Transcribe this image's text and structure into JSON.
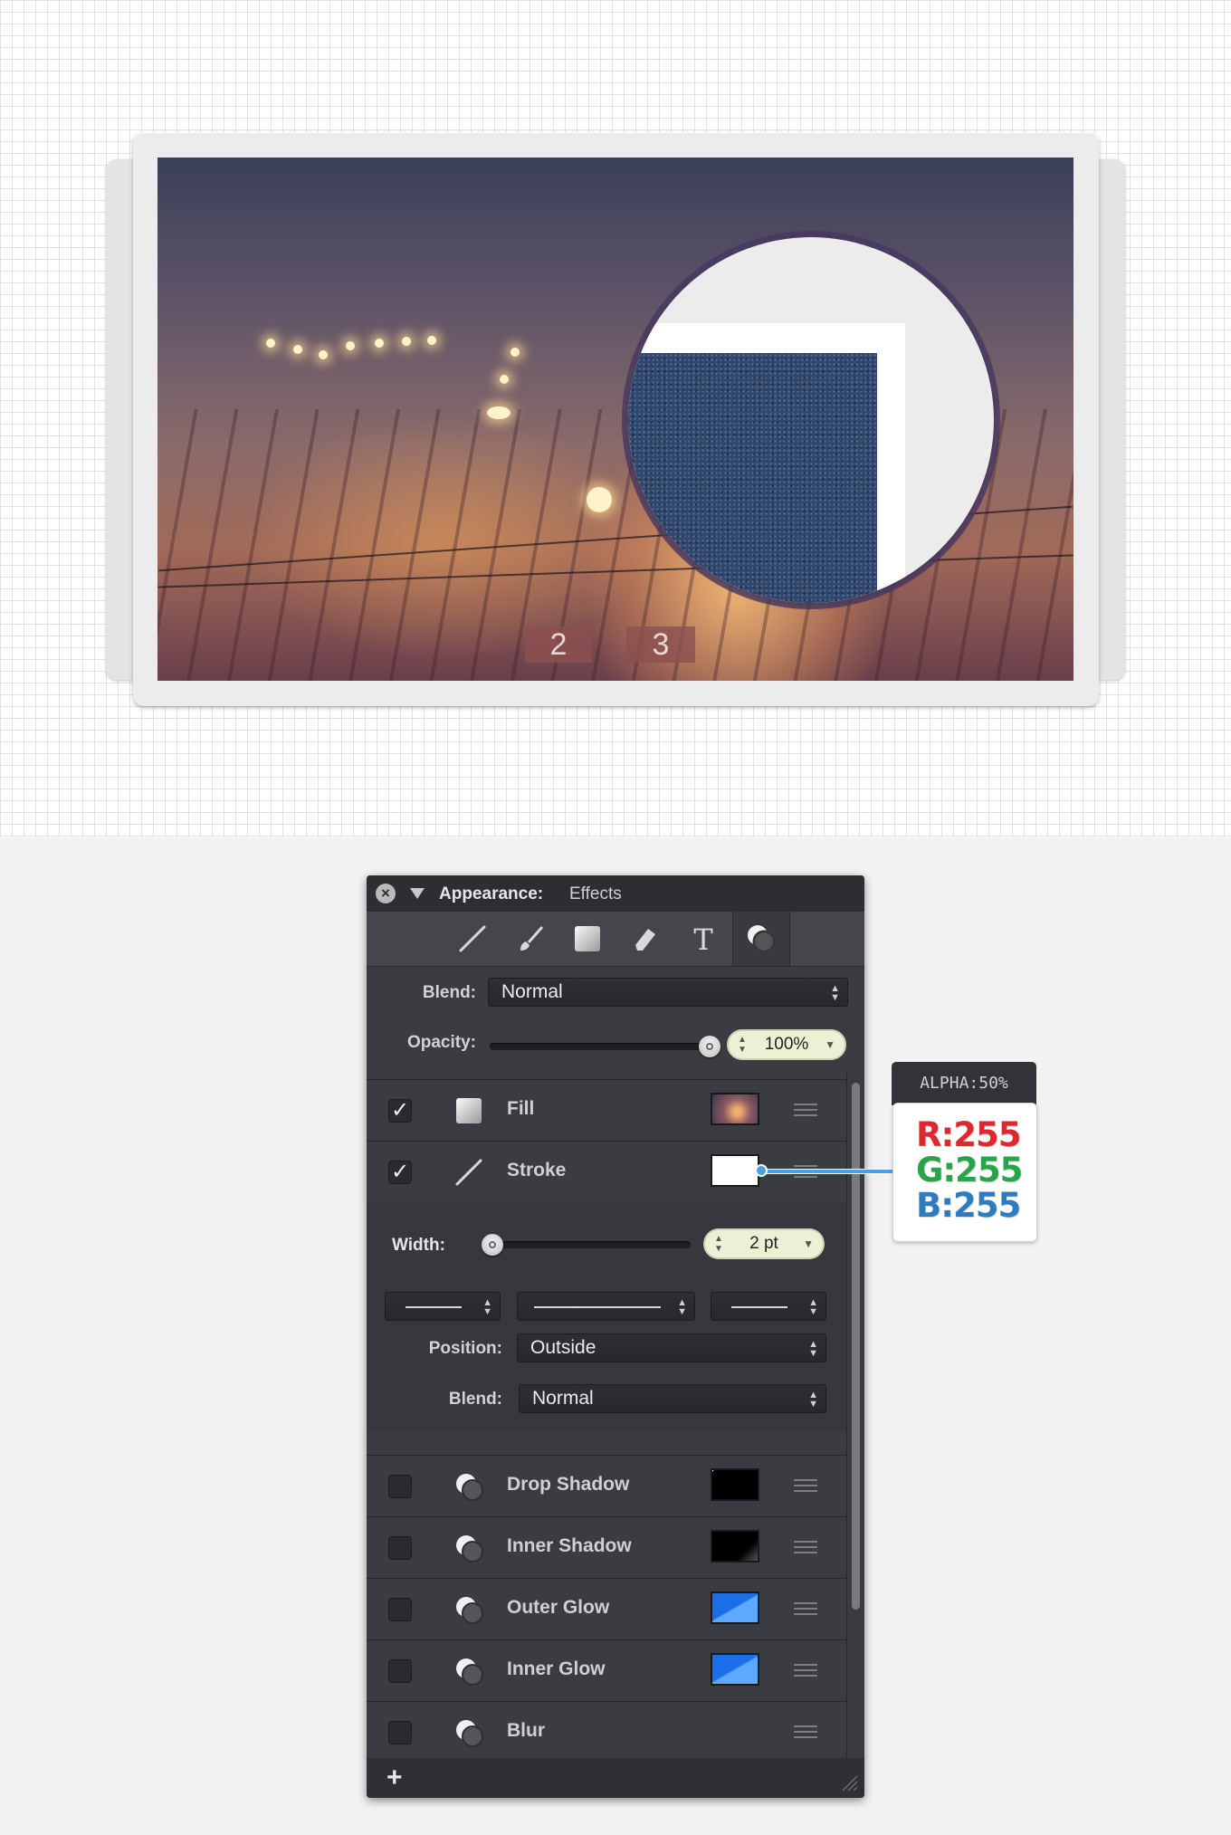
{
  "canvas": {
    "photo": {
      "platform_signs": [
        "2",
        "3"
      ]
    }
  },
  "panel": {
    "title_label": "Appearance:",
    "title_value": "Effects",
    "tools": [
      {
        "name": "line-tool-icon"
      },
      {
        "name": "brush-tool-icon"
      },
      {
        "name": "square-fill-tool-icon"
      },
      {
        "name": "eraser-tool-icon"
      },
      {
        "name": "text-tool-icon"
      },
      {
        "name": "effects-tool-icon",
        "active": true
      }
    ],
    "blend_label": "Blend:",
    "blend_value": "Normal",
    "opacity_label": "Opacity:",
    "opacity_value": "100%",
    "opacity_level": 1.0,
    "fill": {
      "label": "Fill",
      "checked": true
    },
    "stroke": {
      "label": "Stroke",
      "checked": true,
      "color": "#ffffff",
      "width_label": "Width:",
      "width_value": "2 pt",
      "width_level": 0.0,
      "position_label": "Position:",
      "position_value": "Outside",
      "blend_label": "Blend:",
      "blend_value": "Normal"
    },
    "effects": [
      {
        "label": "Drop Shadow",
        "checked": false,
        "swatch": "dark"
      },
      {
        "label": "Inner Shadow",
        "checked": false,
        "swatch": "dark"
      },
      {
        "label": "Outer Glow",
        "checked": false,
        "swatch": "blue"
      },
      {
        "label": "Inner Glow",
        "checked": false,
        "swatch": "blue"
      },
      {
        "label": "Blur",
        "checked": false,
        "swatch": "none"
      }
    ],
    "add_label": "+"
  },
  "callout": {
    "alpha": "ALPHA:50%",
    "r": "R:255",
    "g": "G:255",
    "b": "B:255",
    "colors": {
      "r": "#e0262e",
      "g": "#2aa44a",
      "b": "#2f7bc0"
    }
  }
}
